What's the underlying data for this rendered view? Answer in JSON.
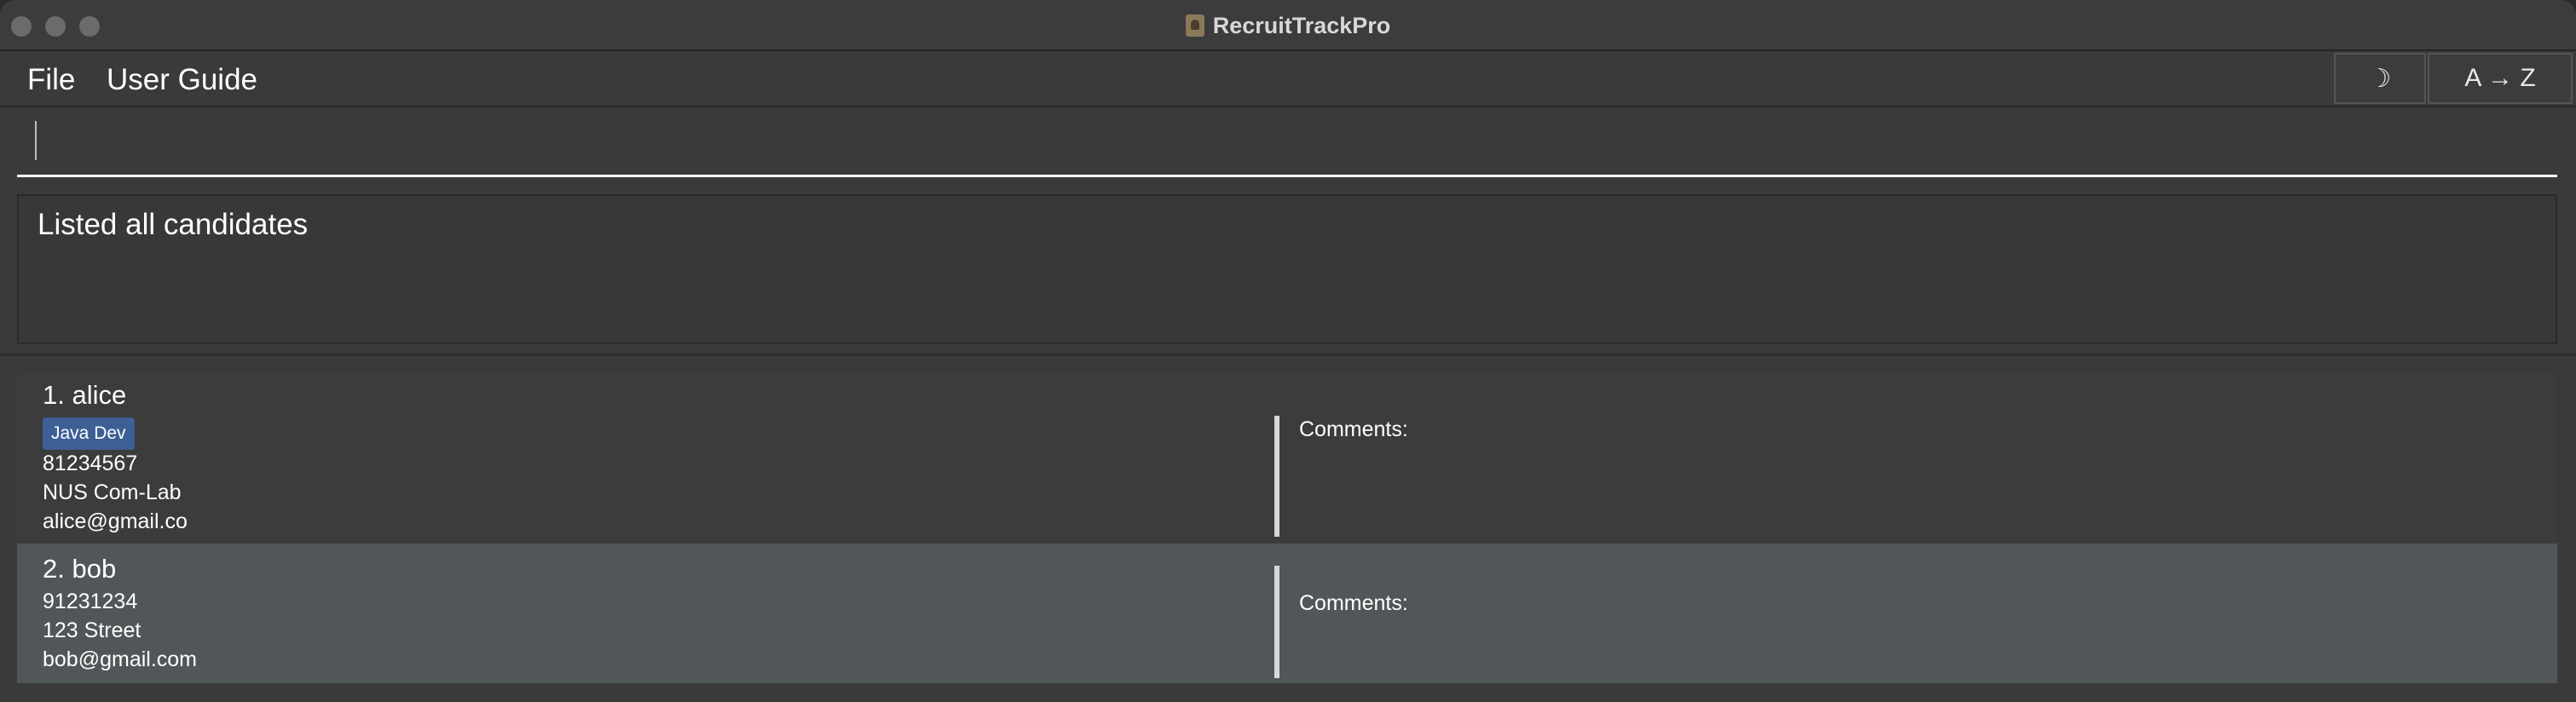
{
  "window": {
    "title": "RecruitTrackPro"
  },
  "menu": {
    "file_label": "File",
    "user_guide_label": "User Guide"
  },
  "toolbar": {
    "theme_toggle_glyph": "☽",
    "sort_label": "A → Z"
  },
  "command": {
    "value": "",
    "placeholder": ""
  },
  "result": {
    "message": "Listed all candidates"
  },
  "candidates": [
    {
      "index_name": "1. alice",
      "tags": [
        "Java Dev"
      ],
      "phone": "81234567",
      "address": "NUS Com-Lab",
      "email": "alice@gmail.co",
      "comments_label": "Comments:"
    },
    {
      "index_name": "2. bob",
      "tags": [],
      "phone": "91231234",
      "address": "123 Street",
      "email": "bob@gmail.com",
      "comments_label": "Comments:"
    }
  ],
  "colors": {
    "background": "#3a3a3a",
    "selected_row": "#515658",
    "tag": "#3e5f95"
  }
}
